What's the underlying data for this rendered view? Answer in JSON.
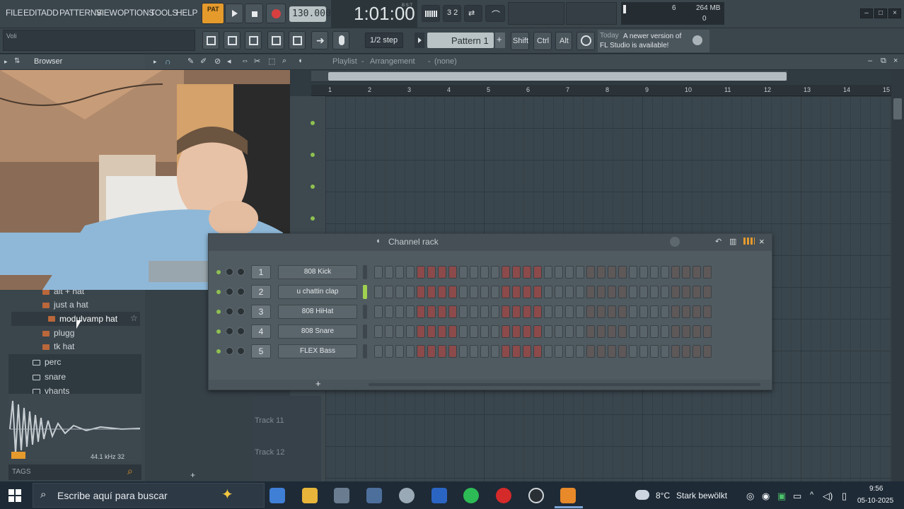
{
  "menu": {
    "items": [
      "FILE",
      "EDIT",
      "ADD",
      "PATTERNS",
      "VIEW",
      "OPTIONS",
      "TOOLS",
      "HELP"
    ],
    "hint": "Voli",
    "pat_song": "PAT"
  },
  "transport": {
    "tempo": "130.000",
    "time": "1:01:00",
    "time_sub": "B:S:T",
    "cpu": "6",
    "memory": "264 MB",
    "voices": "0"
  },
  "toolbar2": {
    "snap": "1/2 step",
    "pattern": "Pattern 1",
    "keys": [
      "Shift",
      "Ctrl",
      "Alt"
    ],
    "news_prefix": "Today",
    "news_text": "A newer version of FL Studio is available!"
  },
  "browser": {
    "title": "Browser",
    "items": [
      {
        "label": "alt + hat",
        "type": "sample"
      },
      {
        "label": "just a hat",
        "type": "sample"
      },
      {
        "label": "modulvamp hat",
        "type": "sample",
        "selected": true
      },
      {
        "label": "plugg",
        "type": "sample"
      },
      {
        "label": "tk hat",
        "type": "sample"
      }
    ],
    "folders": [
      "perc",
      "snare",
      "vhants"
    ],
    "sample_info": "44.1 kHz 32",
    "tags_label": "TAGS"
  },
  "playlist": {
    "title": "Playlist",
    "subtitle": "Arrangement",
    "pattern": "(none)",
    "ruler": [
      "1",
      "2",
      "3",
      "4",
      "5",
      "6",
      "7",
      "8",
      "9",
      "10",
      "11",
      "12",
      "13",
      "14",
      "15"
    ],
    "tracks": [
      "Track 11",
      "Track 12"
    ]
  },
  "channel_rack": {
    "title": "Channel rack",
    "channels": [
      {
        "number": "1",
        "name": "808 Kick"
      },
      {
        "number": "2",
        "name": "u chattin clap"
      },
      {
        "number": "3",
        "name": "808 HiHat"
      },
      {
        "number": "4",
        "name": "808 Snare"
      },
      {
        "number": "5",
        "name": "FLEX Bass"
      }
    ],
    "add_label": "+"
  },
  "taskbar": {
    "search_placeholder": "Escribe aquí para buscar",
    "weather_temp": "8°C",
    "weather_desc": "Stark bewölkt",
    "clock_time": "9:56",
    "clock_date": "05-10-2025"
  },
  "colors": {
    "accent_orange": "#f0a030",
    "step_off": "#5a656b",
    "step_red": "#8c4a4a",
    "led_green": "#8fc050",
    "taskbar": "#1e2a36"
  }
}
